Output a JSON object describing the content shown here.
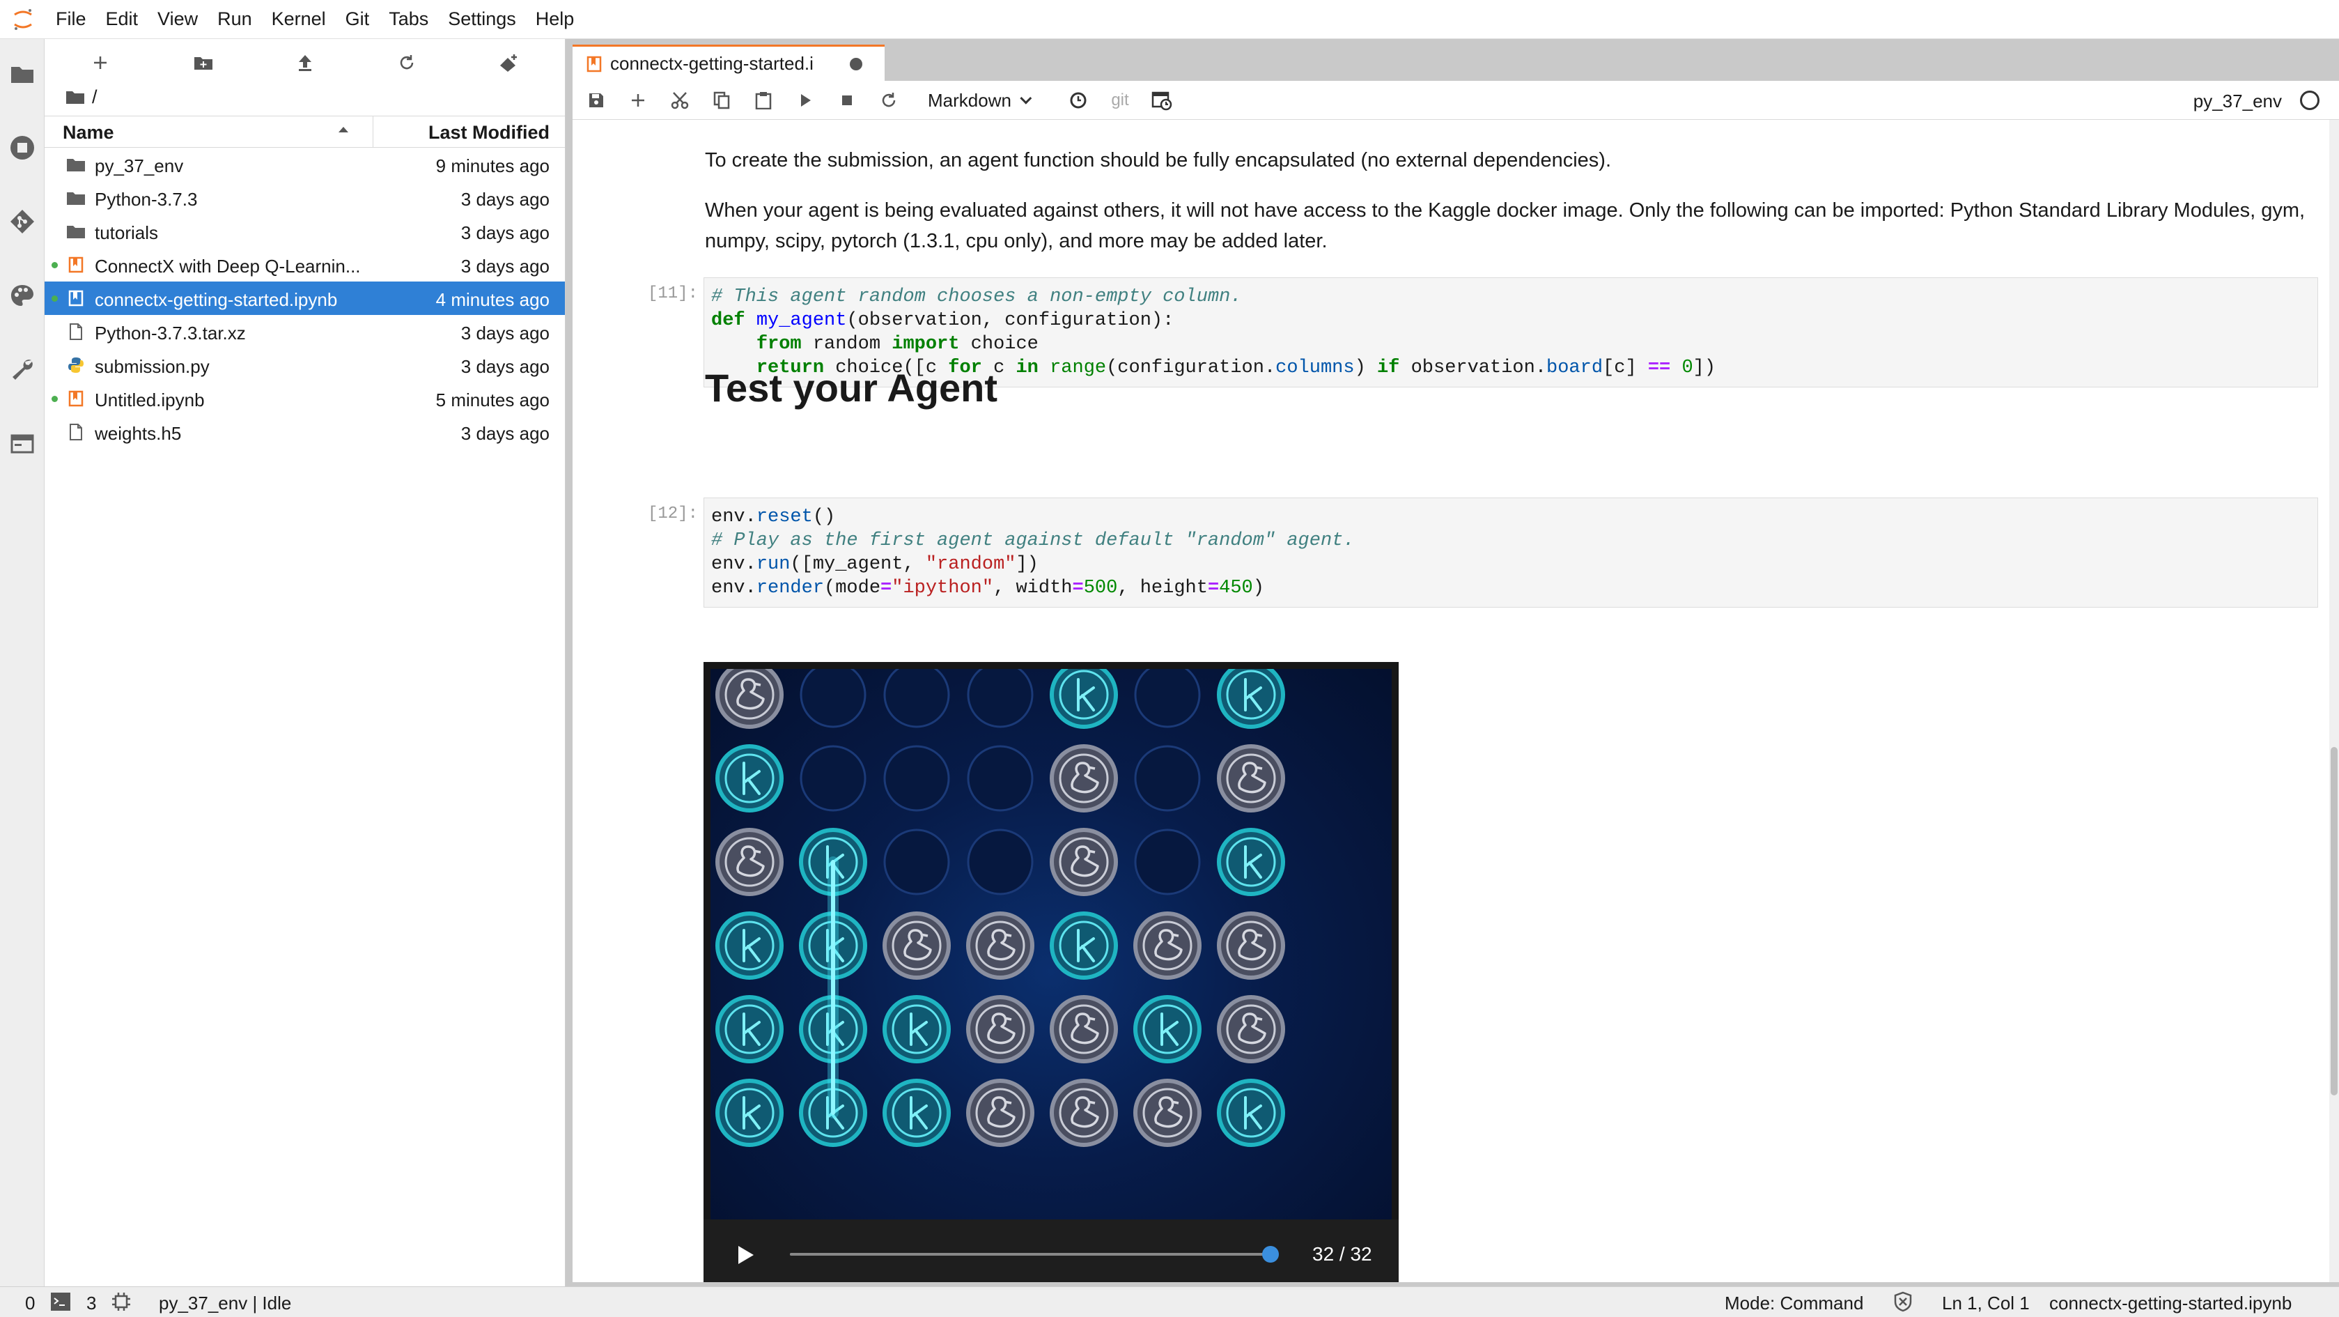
{
  "menubar": {
    "items": [
      "File",
      "Edit",
      "View",
      "Run",
      "Kernel",
      "Git",
      "Tabs",
      "Settings",
      "Help"
    ]
  },
  "activitybar": {
    "icons": [
      "folder-icon",
      "running-icon",
      "git-icon",
      "palette-icon",
      "wrench-icon",
      "tabs-icon"
    ]
  },
  "filebrowser": {
    "toolbar_icons": [
      "new-launcher-icon",
      "new-folder-icon",
      "upload-icon",
      "refresh-icon",
      "git-clone-icon"
    ],
    "breadcrumb": "/",
    "header": {
      "name": "Name",
      "modified": "Last Modified"
    },
    "files": [
      {
        "name": "py_37_env",
        "modified": "9 minutes ago",
        "type": "folder",
        "running": false,
        "selected": false
      },
      {
        "name": "Python-3.7.3",
        "modified": "3 days ago",
        "type": "folder",
        "running": false,
        "selected": false
      },
      {
        "name": "tutorials",
        "modified": "3 days ago",
        "type": "folder",
        "running": false,
        "selected": false
      },
      {
        "name": "ConnectX with Deep Q-Learnin...",
        "modified": "3 days ago",
        "type": "notebook",
        "running": true,
        "selected": false
      },
      {
        "name": "connectx-getting-started.ipynb",
        "modified": "4 minutes ago",
        "type": "notebook",
        "running": true,
        "selected": true
      },
      {
        "name": "Python-3.7.3.tar.xz",
        "modified": "3 days ago",
        "type": "file",
        "running": false,
        "selected": false
      },
      {
        "name": "submission.py",
        "modified": "3 days ago",
        "type": "python",
        "running": false,
        "selected": false
      },
      {
        "name": "Untitled.ipynb",
        "modified": "5 minutes ago",
        "type": "notebook",
        "running": true,
        "selected": false
      },
      {
        "name": "weights.h5",
        "modified": "3 days ago",
        "type": "file",
        "running": false,
        "selected": false
      }
    ]
  },
  "tab": {
    "title": "connectx-getting-started.i"
  },
  "notebook_toolbar": {
    "cell_type": "Markdown",
    "git_label": "git",
    "kernel": "py_37_env"
  },
  "notebook": {
    "md1": "To create the submission, an agent function should be fully encapsulated (no external dependencies).",
    "md2": "When your agent is being evaluated against others, it will not have access to the Kaggle docker image. Only the following can be imported: Python Standard Library Modules, gym, numpy, scipy, pytorch (1.3.1, cpu only), and more may be added later.",
    "prompt11": "[11]:",
    "prompt12": "[12]:",
    "heading": "Test your Agent"
  },
  "game": {
    "step_label": "32 / 32",
    "progress": 1.0,
    "rows": [
      [
        "duck",
        "empty",
        "empty",
        "empty",
        "k",
        "empty",
        "k"
      ],
      [
        "k",
        "empty",
        "empty",
        "empty",
        "duck",
        "empty",
        "duck"
      ],
      [
        "duck",
        "k",
        "empty",
        "empty",
        "duck",
        "empty",
        "k"
      ],
      [
        "k",
        "k",
        "duck",
        "duck",
        "k",
        "duck",
        "duck"
      ],
      [
        "k",
        "k",
        "k",
        "duck",
        "duck",
        "k",
        "duck"
      ],
      [
        "k",
        "k",
        "k",
        "duck",
        "duck",
        "duck",
        "k"
      ]
    ],
    "win_column": 1,
    "win_rows": [
      2,
      5
    ]
  },
  "statusbar": {
    "terminals": "0",
    "kernels": "3",
    "kernel_status": "py_37_env | Idle",
    "mode": "Mode: Command",
    "position": "Ln 1, Col 1",
    "filename": "connectx-getting-started.ipynb"
  },
  "colors": {
    "accent": "#f37726",
    "selection": "#2f80d6",
    "piece_k": "#1fb5c2",
    "piece_duck": "#8a8fa0",
    "slider": "#3b8fde"
  }
}
